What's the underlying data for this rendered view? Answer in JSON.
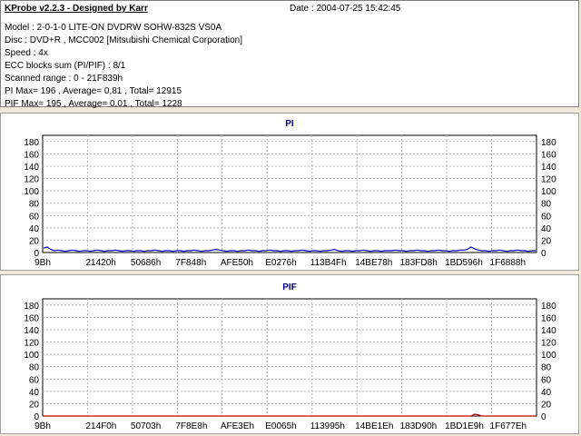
{
  "header": {
    "title": "KProbe v2.2.3 - Designed by Karr",
    "date": "Date : 2004-07-25 15:42:45"
  },
  "info_lines": [
    "Model : 2-0-1-0 LITE-ON DVDRW SOHW-832S  VS0A",
    "Disc : DVD+R , MCC002 [Mitsubishi Chemical Corporation]",
    "Speed : 4x",
    "ECC blocks sum (PI/PIF) : 8/1",
    "Scanned range : 0 - 21F839h",
    "PI Max= 196 , Average= 0,81 , Total= 12915",
    "PIF Max= 195 , Average= 0,01 , Total= 1228"
  ],
  "chart_data": [
    {
      "type": "line",
      "title": "PI",
      "ylim": [
        0,
        190
      ],
      "yticks": [
        0,
        20,
        40,
        60,
        80,
        100,
        120,
        140,
        160,
        180
      ],
      "xtick_labels": [
        "9Bh",
        "21420h",
        "50686h",
        "7F848h",
        "AFE50h",
        "E0276h",
        "113B4Fh",
        "14BE78h",
        "183FD8h",
        "1BD596h",
        "1F6888h"
      ],
      "series": [
        {
          "color": "#0000c8",
          "values": [
            7,
            9,
            5,
            3,
            4,
            3,
            2,
            3,
            4,
            3,
            2,
            3,
            3,
            2,
            3,
            4,
            3,
            2,
            3,
            3,
            4,
            3,
            2,
            3,
            3,
            2,
            3,
            3,
            2,
            3,
            3,
            4,
            3,
            2,
            3,
            3,
            2,
            3,
            3,
            2,
            3,
            3,
            4,
            3,
            2,
            3,
            3,
            4,
            5,
            4,
            3,
            2,
            3,
            3,
            2,
            3,
            3,
            4,
            3,
            3,
            2,
            3,
            3,
            4,
            3,
            3,
            2,
            3,
            3,
            2,
            3,
            3,
            4,
            3,
            2,
            3,
            3,
            2,
            3,
            3,
            4,
            5,
            3,
            2,
            3,
            3,
            2,
            3,
            3,
            4,
            3,
            2,
            3,
            3,
            2,
            3,
            3,
            3,
            4,
            3,
            3,
            2,
            3,
            3,
            4,
            3,
            3,
            2,
            3,
            3,
            4,
            3,
            3,
            2,
            3,
            3,
            4,
            4,
            5,
            9,
            6,
            4,
            3,
            3,
            2,
            3,
            3,
            4,
            3,
            2,
            3,
            3,
            4,
            3,
            3,
            2,
            3,
            3
          ]
        }
      ]
    },
    {
      "type": "line",
      "title": "PIF",
      "ylim": [
        0,
        190
      ],
      "yticks": [
        0,
        20,
        40,
        60,
        80,
        100,
        120,
        140,
        160,
        180
      ],
      "xtick_labels": [
        "9Bh",
        "214F0h",
        "50703h",
        "7F8E8h",
        "AFE3Eh",
        "E0065h",
        "113995h",
        "14BE1Eh",
        "183D90h",
        "1BD1E9h",
        "1F677Eh"
      ],
      "series": [
        {
          "color": "#c00000",
          "values": [
            0,
            0,
            0,
            0,
            0,
            0,
            0,
            0,
            0,
            0,
            0,
            0,
            0,
            0,
            0,
            0,
            0,
            0,
            0,
            0,
            0,
            0,
            0,
            0,
            0,
            0,
            0,
            0,
            0,
            0,
            0,
            0,
            0,
            0,
            0,
            0,
            0,
            0,
            0,
            0,
            0,
            0,
            0,
            0,
            0,
            0,
            0,
            0,
            0,
            0,
            0,
            0,
            0,
            0,
            0,
            0,
            0,
            0,
            0,
            0,
            0,
            0,
            0,
            0,
            0,
            0,
            0,
            0,
            0,
            0,
            0,
            0,
            0,
            0,
            0,
            0,
            0,
            0,
            0,
            0,
            0,
            0,
            0,
            0,
            0,
            0,
            0,
            0,
            0,
            0,
            0,
            0,
            0,
            0,
            0,
            0,
            0,
            0,
            0,
            0,
            0,
            0,
            0,
            0,
            0,
            0,
            0,
            0,
            0,
            0,
            0,
            0,
            0,
            0,
            0,
            0,
            0,
            0,
            0,
            0,
            3,
            2,
            0,
            0,
            0,
            0,
            0,
            0,
            0,
            0,
            0,
            0,
            0,
            0,
            0,
            0,
            0,
            0
          ]
        }
      ]
    }
  ]
}
